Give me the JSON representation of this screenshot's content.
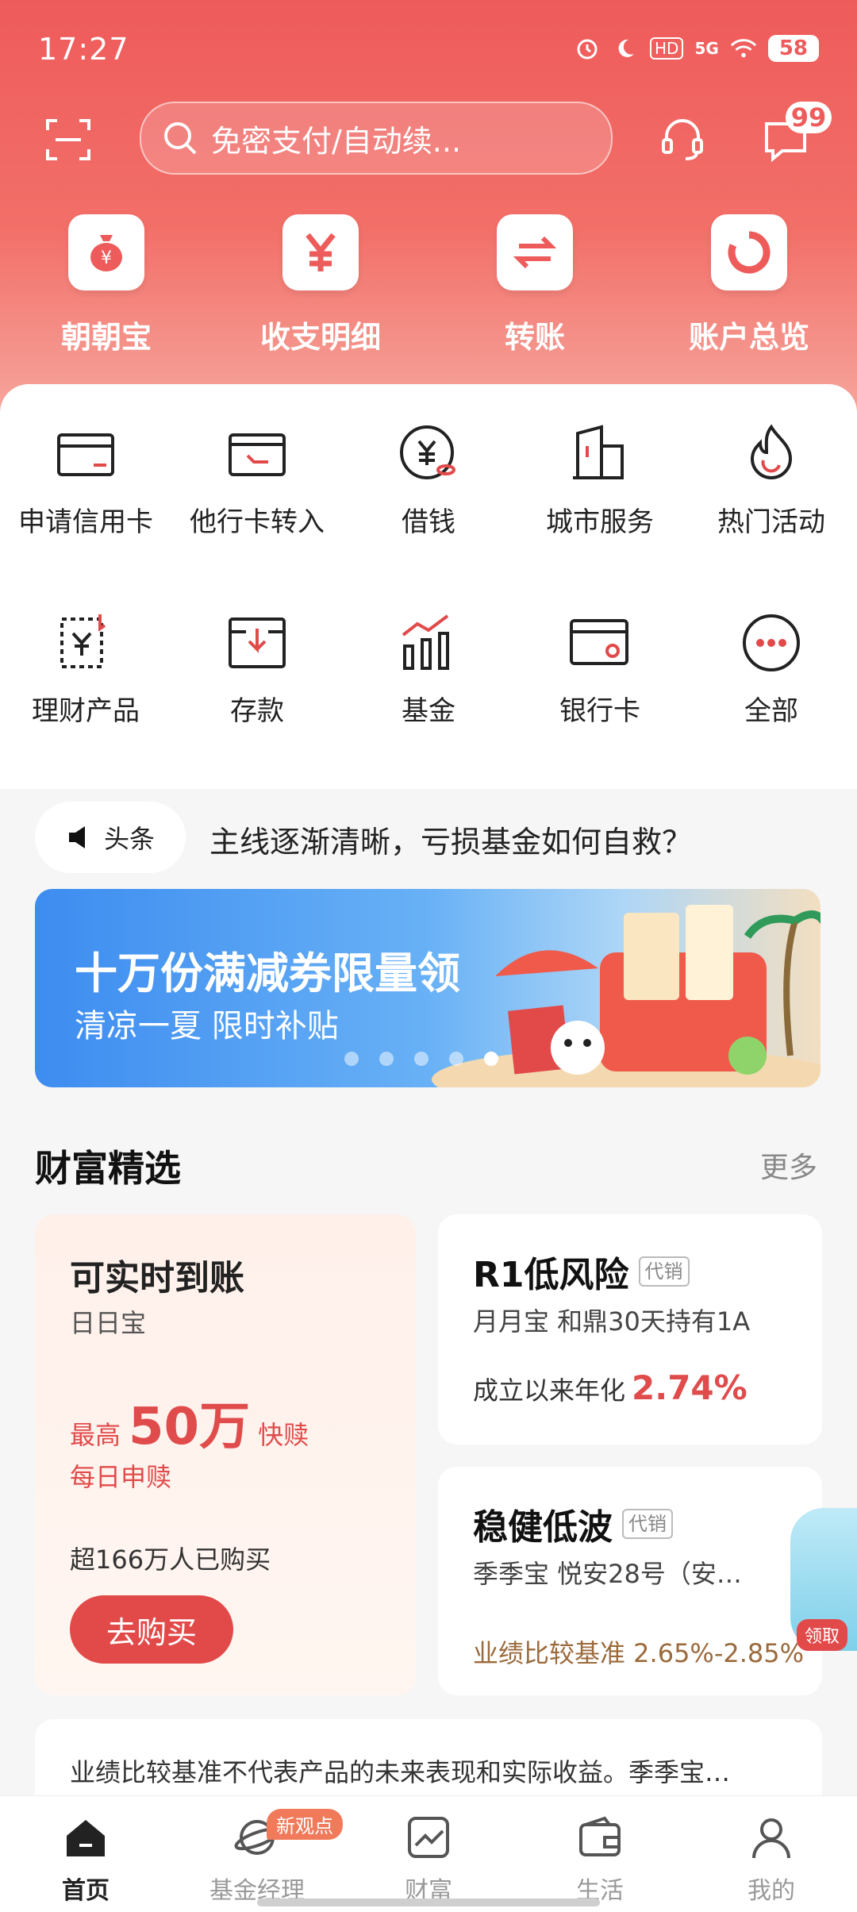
{
  "status_bar": {
    "time": "17:27",
    "hd": "HD",
    "network": "5G",
    "battery": "58"
  },
  "header": {
    "search_placeholder": "免密支付/自动续...",
    "message_badge": "99"
  },
  "quick_actions": [
    {
      "label": "朝朝宝",
      "icon": "money-bag-icon"
    },
    {
      "label": "收支明细",
      "icon": "yen-icon"
    },
    {
      "label": "转账",
      "icon": "transfer-arrows-icon"
    },
    {
      "label": "账户总览",
      "icon": "ring-chart-icon"
    }
  ],
  "service_grid": [
    {
      "label": "申请信用卡",
      "icon": "credit-card-icon"
    },
    {
      "label": "他行卡转入",
      "icon": "card-transfer-icon"
    },
    {
      "label": "借钱",
      "icon": "yen-coin-icon"
    },
    {
      "label": "城市服务",
      "icon": "city-building-icon"
    },
    {
      "label": "热门活动",
      "icon": "flame-icon"
    },
    {
      "label": "理财产品",
      "icon": "finance-product-icon"
    },
    {
      "label": "存款",
      "icon": "deposit-icon"
    },
    {
      "label": "基金",
      "icon": "fund-chart-icon"
    },
    {
      "label": "银行卡",
      "icon": "bank-card-icon"
    },
    {
      "label": "全部",
      "icon": "more-dots-icon"
    }
  ],
  "news": {
    "tag": "头条",
    "headline": "主线逐渐清晰，亏损基金如何自救？"
  },
  "banner": {
    "title": "十万份满减券限量领",
    "subtitle": "清凉一夏 限时补贴",
    "slides": 5,
    "active_slide": 5
  },
  "wealth": {
    "section_title": "财富精选",
    "more_label": "更多",
    "left_card": {
      "title": "可实时到账",
      "product": "日日宝",
      "max_prefix": "最高",
      "max_amount": "50万",
      "max_suffix": "快赎",
      "daily": "每日申赎",
      "buyers": "超166万人已购买",
      "cta": "去购买"
    },
    "right_cards": [
      {
        "title": "R1低风险",
        "tag": "代销",
        "products": "月月宝  和鼎30天持有1A",
        "rate_label": "成立以来年化",
        "rate_value": "2.74%"
      },
      {
        "title": "稳健低波",
        "tag": "代销",
        "products": "季季宝  悦安28号（安…",
        "benchmark": "业绩比较基准 2.65%-2.85%"
      }
    ],
    "float_label": "领取"
  },
  "disclaimer": "业绩比较基准不代表产品的未来表现和实际收益。季季宝…",
  "tabbar": [
    {
      "label": "首页",
      "icon": "home-icon",
      "active": true
    },
    {
      "label": "基金经理",
      "icon": "planet-icon",
      "badge": "新观点"
    },
    {
      "label": "财富",
      "icon": "wealth-chart-icon"
    },
    {
      "label": "生活",
      "icon": "wallet-icon"
    },
    {
      "label": "我的",
      "icon": "person-icon"
    }
  ],
  "colors": {
    "brand": "#ee5b5b",
    "accent_red": "#e24a4a",
    "benchmark": "#9b6a3c"
  }
}
